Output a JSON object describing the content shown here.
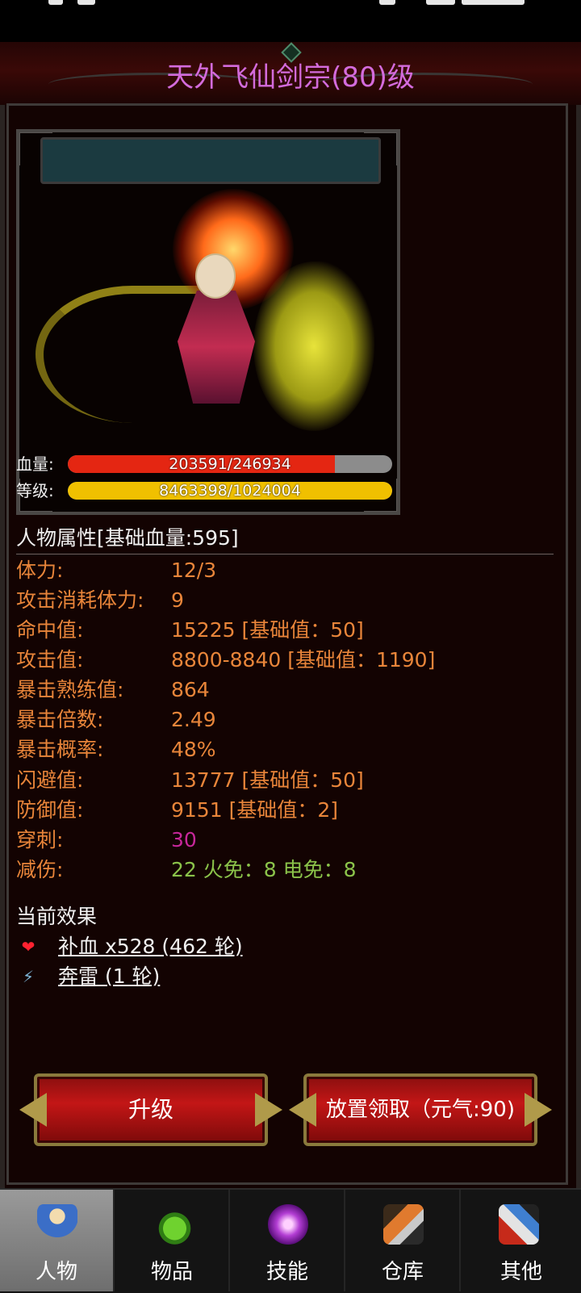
{
  "title": "天外飞仙剑宗(80)级",
  "bars": {
    "hp": {
      "label": "血量:",
      "text": "203591/246934",
      "fraction": 0.8245
    },
    "level": {
      "label": "等级:",
      "text": "8463398/1024004",
      "fraction": 1.0
    }
  },
  "attributes": {
    "heading": "人物属性[基础血量:595]",
    "rows": [
      {
        "label": "体力:",
        "value": "12/3"
      },
      {
        "label": "攻击消耗体力:",
        "value": "9"
      },
      {
        "label": "命中值:",
        "value": "15225 [基础值：50]"
      },
      {
        "label": "攻击值:",
        "value": "8800-8840 [基础值：1190]"
      },
      {
        "label": "暴击熟练值:",
        "value": "864"
      },
      {
        "label": "暴击倍数:",
        "value": "2.49"
      },
      {
        "label": "暴击概率:",
        "value": "48%"
      },
      {
        "label": "闪避值:",
        "value": "13777 [基础值：50]"
      },
      {
        "label": "防御值:",
        "value": "9151 [基础值：2]"
      },
      {
        "label": "穿刺:",
        "value": "30"
      },
      {
        "label": "减伤:",
        "value": "22 火免：8 电免：8"
      }
    ]
  },
  "effects": {
    "heading": "当前效果",
    "items": [
      {
        "icon": "heart-icon",
        "glyph": "❤",
        "text": "补血 x528 (462 轮)"
      },
      {
        "icon": "lightning-icon",
        "glyph": "⚡",
        "text": "奔雷 (1 轮)"
      }
    ]
  },
  "buttons": {
    "upgrade": "升级",
    "idle_claim": "放置领取（元气:90)"
  },
  "nav": [
    {
      "label": "人物",
      "icon": "character-icon",
      "active": true
    },
    {
      "label": "物品",
      "icon": "potion-icon",
      "active": false
    },
    {
      "label": "技能",
      "icon": "skill-orb-icon",
      "active": false
    },
    {
      "label": "仓库",
      "icon": "storage-icon",
      "active": false
    },
    {
      "label": "其他",
      "icon": "sword-icon",
      "active": false
    }
  ],
  "colors": {
    "title": "#d36bdc",
    "attribute": "#e8853a",
    "pierce": "#c7279a",
    "damage_reduction": "#8bc34a",
    "hp_bar": "#e42612",
    "level_bar": "#f0c000"
  }
}
